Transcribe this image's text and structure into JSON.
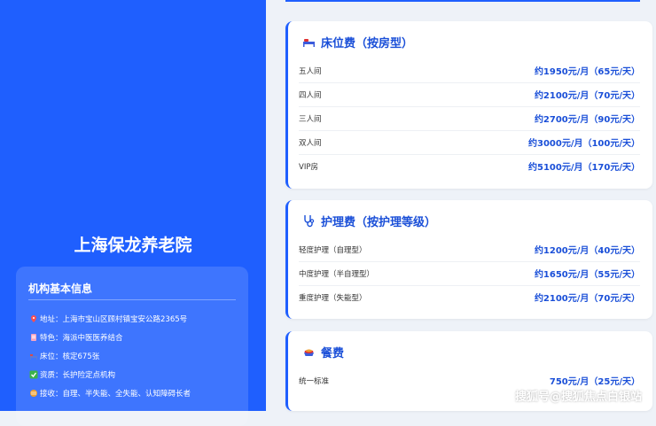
{
  "org": {
    "name": "上海保龙养老院",
    "info_title": "机构基本信息",
    "lines": [
      {
        "icon": "pin-icon",
        "text": "地址：上海市宝山区顾村镇宝安公路2365号"
      },
      {
        "icon": "herb-icon",
        "text": "特色：海派中医医养结合"
      },
      {
        "icon": "bed-icon",
        "text": "床位：核定675张"
      },
      {
        "icon": "check-icon",
        "text": "资质：长护险定点机构"
      },
      {
        "icon": "ball-icon",
        "text": "接收：自理、半失能、全失能、认知障碍长者"
      }
    ]
  },
  "bed_fee": {
    "title": "床位费（按房型）",
    "rows": [
      {
        "label": "五人间",
        "price": "约1950元/月（65元/天）"
      },
      {
        "label": "四人间",
        "price": "约2100元/月（70元/天）"
      },
      {
        "label": "三人间",
        "price": "约2700元/月（90元/天）"
      },
      {
        "label": "双人间",
        "price": "约3000元/月（100元/天）"
      },
      {
        "label": "VIP房",
        "price": "约5100元/月（170元/天）"
      }
    ]
  },
  "care_fee": {
    "title": "护理费（按护理等级）",
    "rows": [
      {
        "label": "轻度护理（自理型）",
        "price": "约1200元/月（40元/天）"
      },
      {
        "label": "中度护理（半自理型）",
        "price": "约1650元/月（55元/天）"
      },
      {
        "label": "重度护理（失能型）",
        "price": "约2100元/月（70元/天）"
      }
    ]
  },
  "meal_fee": {
    "title": "餐费",
    "rows": [
      {
        "label": "统一标准",
        "price": "750元/月（25元/天）"
      }
    ]
  },
  "watermark": "搜狐号@搜狐焦点白银站",
  "colors": {
    "accent": "#1f5ffe",
    "price": "#1a4fd8"
  }
}
